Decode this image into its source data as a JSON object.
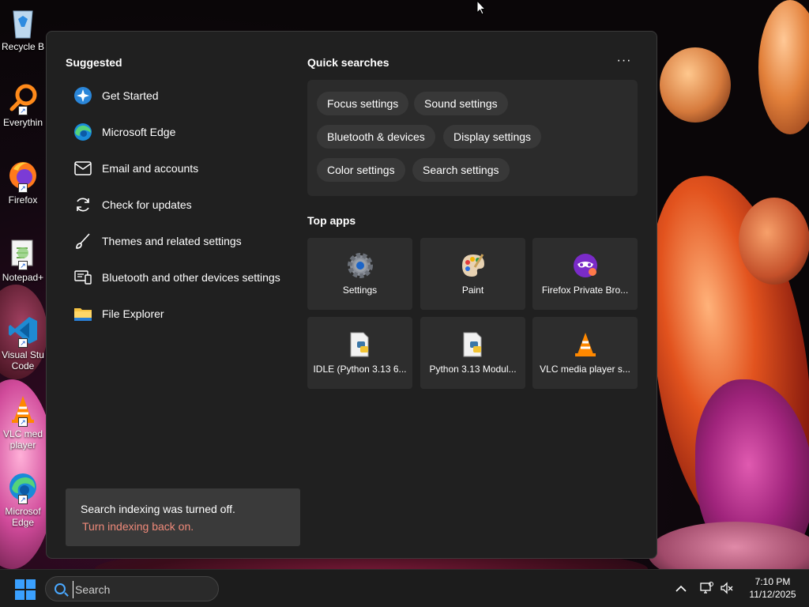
{
  "desktop": {
    "icons": [
      {
        "label": "Recycle B",
        "icon": "recycle-bin-icon"
      },
      {
        "label": "Everythin",
        "icon": "everything-search-icon"
      },
      {
        "label": "Firefox",
        "icon": "firefox-icon"
      },
      {
        "label": "Notepad+",
        "icon": "notepad-plus-plus-icon"
      },
      {
        "label": "Visual Stu",
        "label2": "Code",
        "icon": "vscode-icon"
      },
      {
        "label": "VLC med",
        "label2": "player",
        "icon": "vlc-icon"
      },
      {
        "label": "Microsof",
        "label2": "Edge",
        "icon": "edge-icon"
      }
    ]
  },
  "panel": {
    "suggested_title": "Suggested",
    "suggested": [
      {
        "label": "Get Started",
        "icon": "get-started-icon"
      },
      {
        "label": "Microsoft Edge",
        "icon": "edge-icon"
      },
      {
        "label": "Email and accounts",
        "icon": "mail-icon"
      },
      {
        "label": "Check for updates",
        "icon": "refresh-icon"
      },
      {
        "label": "Themes and related settings",
        "icon": "brush-icon"
      },
      {
        "label": "Bluetooth and other devices settings",
        "icon": "devices-icon"
      },
      {
        "label": "File Explorer",
        "icon": "folder-icon"
      }
    ],
    "quick_title": "Quick searches",
    "more_label": "···",
    "quick_searches": [
      "Focus settings",
      "Sound settings",
      "Bluetooth & devices",
      "Display settings",
      "Color settings",
      "Search settings"
    ],
    "top_apps_title": "Top apps",
    "top_apps": [
      {
        "label": "Settings",
        "icon": "settings-gear-icon"
      },
      {
        "label": "Paint",
        "icon": "paint-palette-icon"
      },
      {
        "label": "Firefox Private Bro...",
        "icon": "firefox-private-icon"
      },
      {
        "label": "IDLE (Python 3.13 6...",
        "icon": "python-file-icon"
      },
      {
        "label": "Python 3.13 Modul...",
        "icon": "python-file-icon"
      },
      {
        "label": "VLC media player s...",
        "icon": "vlc-cone-icon"
      }
    ],
    "indexing": {
      "message": "Search indexing was turned off.",
      "link": "Turn indexing back on."
    }
  },
  "taskbar": {
    "search_placeholder": "Search",
    "time": "7:10 PM",
    "date": "11/12/2025",
    "accent": "#3aa0ff"
  }
}
